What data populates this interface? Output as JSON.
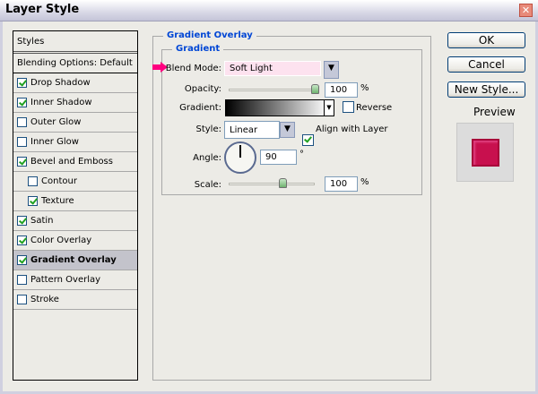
{
  "window": {
    "title": "Layer Style"
  },
  "styles_list": {
    "header": "Styles",
    "blending": "Blending Options: Default",
    "items": [
      {
        "label": "Drop Shadow",
        "checked": true
      },
      {
        "label": "Inner Shadow",
        "checked": true
      },
      {
        "label": "Outer Glow",
        "checked": false
      },
      {
        "label": "Inner Glow",
        "checked": false
      },
      {
        "label": "Bevel and Emboss",
        "checked": true
      },
      {
        "label": "Contour",
        "checked": false
      },
      {
        "label": "Texture",
        "checked": true
      },
      {
        "label": "Satin",
        "checked": true
      },
      {
        "label": "Color Overlay",
        "checked": true
      },
      {
        "label": "Gradient Overlay",
        "checked": true,
        "selected": true
      },
      {
        "label": "Pattern Overlay",
        "checked": false
      },
      {
        "label": "Stroke",
        "checked": false
      }
    ]
  },
  "panel": {
    "title": "Gradient Overlay",
    "group": "Gradient",
    "blend_mode_label": "Blend Mode:",
    "blend_mode": "Soft Light",
    "opacity_label": "Opacity:",
    "opacity": "100",
    "opacity_unit": "%",
    "gradient_label": "Gradient:",
    "reverse_label": "Reverse",
    "reverse": false,
    "style_label": "Style:",
    "style": "Linear",
    "align_label": "Align with Layer",
    "align": true,
    "angle_label": "Angle:",
    "angle": "90",
    "angle_unit": "°",
    "scale_label": "Scale:",
    "scale": "100",
    "scale_unit": "%"
  },
  "buttons": {
    "ok": "OK",
    "cancel": "Cancel",
    "new_style": "New Style...",
    "preview": "Preview",
    "preview_checked": true
  },
  "colors": {
    "accent": "#0046d5",
    "arrow": "#ff0080",
    "preview": "#c8104e",
    "blend_bg": "#fde2ef"
  }
}
